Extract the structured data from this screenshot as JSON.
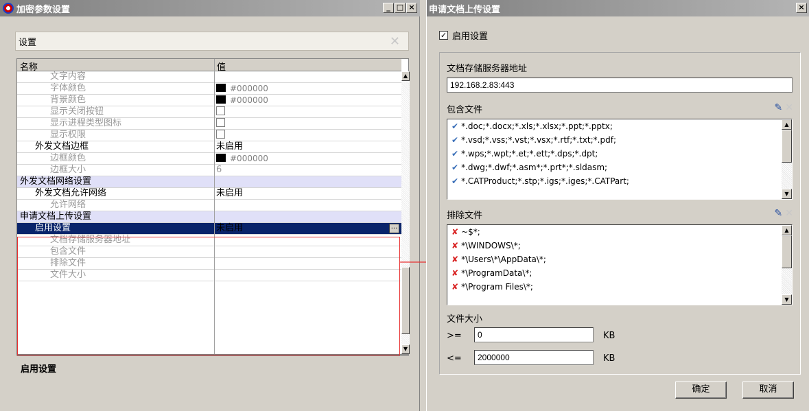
{
  "left_window": {
    "title": "加密参数设置",
    "controls": {
      "minimize": "_",
      "maximize": "□",
      "close": "×"
    },
    "settings_header": "设置",
    "columns": {
      "name": "名称",
      "value": "值"
    },
    "rows": [
      {
        "name": "文字内容",
        "value": "",
        "kind": "text",
        "indent": 2,
        "grey": true
      },
      {
        "name": "字体颜色",
        "value": "#000000",
        "kind": "color",
        "indent": 2,
        "grey": true
      },
      {
        "name": "背景颜色",
        "value": "#000000",
        "kind": "color",
        "indent": 2,
        "grey": true
      },
      {
        "name": "显示关闭按钮",
        "value": "",
        "kind": "check",
        "indent": 2,
        "grey": true
      },
      {
        "name": "显示进程类型图标",
        "value": "",
        "kind": "check",
        "indent": 2,
        "grey": true
      },
      {
        "name": "显示权限",
        "value": "",
        "kind": "check",
        "indent": 2,
        "grey": true
      },
      {
        "name": "外发文档边框",
        "value": "未启用",
        "kind": "text",
        "indent": 1,
        "grey": false
      },
      {
        "name": "边框颜色",
        "value": "#000000",
        "kind": "color",
        "indent": 2,
        "grey": true
      },
      {
        "name": "边框大小",
        "value": "6",
        "kind": "text",
        "indent": 2,
        "grey": true
      },
      {
        "name": "外发文档网络设置",
        "value": "",
        "kind": "section",
        "indent": 0,
        "grey": false
      },
      {
        "name": "外发文档允许网络",
        "value": "未启用",
        "kind": "text",
        "indent": 1,
        "grey": false
      },
      {
        "name": "允许网络",
        "value": "",
        "kind": "text",
        "indent": 2,
        "grey": true
      },
      {
        "name": "申请文档上传设置",
        "value": "",
        "kind": "section",
        "indent": 0,
        "grey": false
      },
      {
        "name": "启用设置",
        "value": "未启用",
        "kind": "selected",
        "indent": 1,
        "grey": false
      },
      {
        "name": "文档存储服务器地址",
        "value": "",
        "kind": "text",
        "indent": 2,
        "grey": true
      },
      {
        "name": "包含文件",
        "value": "",
        "kind": "text",
        "indent": 2,
        "grey": true
      },
      {
        "name": "排除文件",
        "value": "",
        "kind": "text",
        "indent": 2,
        "grey": true
      },
      {
        "name": "文件大小",
        "value": "",
        "kind": "text",
        "indent": 2,
        "grey": true
      }
    ],
    "ellipsis_label": "...",
    "description_title": "启用设置"
  },
  "right_window": {
    "title": "申请文档上传设置",
    "close": "×",
    "enable_checkbox": {
      "label": "启用设置",
      "checked": true,
      "mark": "✓"
    },
    "server_label": "文档存储服务器地址",
    "server_value": "192.168.2.83:443",
    "include_label": "包含文件",
    "include_items": [
      "*.doc;*.docx;*.xls;*.xlsx;*.ppt;*.pptx;",
      "*.vsd;*.vss;*.vst;*.vsx;*.rtf;*.txt;*.pdf;",
      "*.wps;*.wpt;*.et;*.ett;*.dps;*.dpt;",
      "*.dwg;*.dwf;*.asm*;*.prt*;*.sldasm;",
      "*.CATProduct;*.stp;*.igs;*.iges;*.CATPart;"
    ],
    "exclude_label": "排除文件",
    "exclude_items": [
      "~$*;",
      "*\\WINDOWS\\*;",
      "*\\Users\\*\\AppData\\*;",
      "*\\ProgramData\\*;",
      "*\\Program Files\\*;"
    ],
    "size_label": "文件大小",
    "min": {
      "op": ">=",
      "value": "0",
      "unit": "KB"
    },
    "max": {
      "op": "<=",
      "value": "2000000",
      "unit": "KB"
    },
    "ok_label": "确定",
    "cancel_label": "取消",
    "icons": {
      "check": "✔",
      "cross": "✘",
      "edit": "✎",
      "delete": "✕"
    }
  },
  "colors": {
    "selection": "#0a246a",
    "section_bg": "#e0e0f8",
    "highlight_border": "#e83030"
  }
}
